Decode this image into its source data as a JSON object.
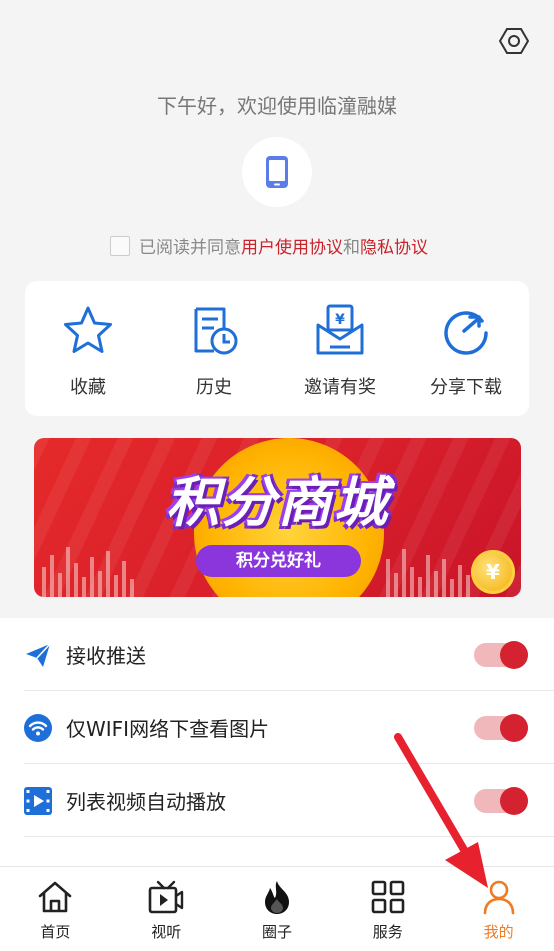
{
  "header": {
    "greeting": "下午好，欢迎使用临潼融媒",
    "settings_icon": "gear-icon",
    "phone_icon": "phone-icon"
  },
  "agreement": {
    "prefix": "已阅读并同意",
    "user_agreement": "用户使用协议",
    "and": "和",
    "privacy": "隐私协议",
    "checked": false
  },
  "quick_actions": [
    {
      "label": "收藏",
      "icon": "star-icon"
    },
    {
      "label": "历史",
      "icon": "history-icon"
    },
    {
      "label": "邀请有奖",
      "icon": "invite-envelope-icon"
    },
    {
      "label": "分享下载",
      "icon": "share-icon"
    }
  ],
  "banner": {
    "title": "积分商城",
    "subtitle": "积分兑好礼",
    "coin_symbol": "¥"
  },
  "settings": [
    {
      "label": "接收推送",
      "icon": "send-icon",
      "enabled": true
    },
    {
      "label": "仅WIFI网络下查看图片",
      "icon": "wifi-icon",
      "enabled": true
    },
    {
      "label": "列表视频自动播放",
      "icon": "video-icon",
      "enabled": true
    }
  ],
  "tabbar": [
    {
      "label": "首页",
      "icon": "home-icon",
      "active": false
    },
    {
      "label": "视听",
      "icon": "tv-icon",
      "active": false
    },
    {
      "label": "圈子",
      "icon": "flame-icon",
      "active": false
    },
    {
      "label": "服务",
      "icon": "grid-icon",
      "active": false
    },
    {
      "label": "我的",
      "icon": "user-icon",
      "active": true
    }
  ],
  "colors": {
    "accent_blue": "#1f6fd8",
    "accent_red": "#c9222b",
    "active_tab": "#f07b25",
    "toggle_on": "#d42230"
  }
}
